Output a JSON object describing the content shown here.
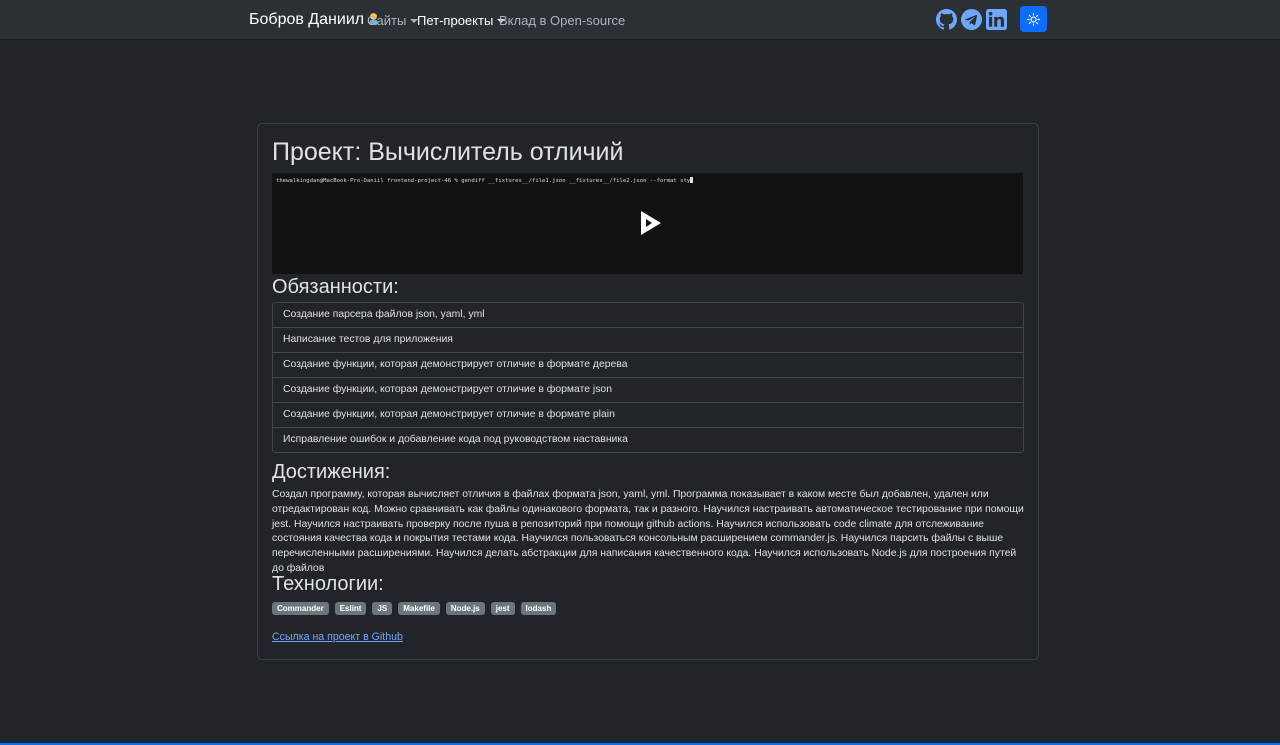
{
  "navbar": {
    "brand": "Бобров Даниил",
    "brand_emoji": "person-blond-hair-emoji",
    "items": [
      {
        "label": "Сайты",
        "dropdown": true,
        "active": false
      },
      {
        "label": "Пет-проекты",
        "dropdown": true,
        "active": true
      },
      {
        "label": "Вклад в Open-source",
        "dropdown": false,
        "active": false
      }
    ],
    "social_icons": [
      "github-icon",
      "telegram-icon",
      "linkedin-icon"
    ],
    "theme_toggle_icon": "sun-icon",
    "accent_color": "#0d6efd"
  },
  "project": {
    "title": "Проект: Вычислитель отличий",
    "demo": {
      "terminal_text": "thewalkingdan@MacBook-Pro-Daniil frontend-project-46 % gendiff __fixtures__/file1.json __fixtures__/file2.json --format sty",
      "play_icon": "play-icon"
    },
    "duties_heading": "Обязанности:",
    "duties": [
      "Создание парсера файлов json, yaml, yml",
      "Написание тестов для приложения",
      "Создание функции, которая демонстрирует отличие в формате дерева",
      "Создание функции, которая демонстрирует отличие в формате json",
      "Создание функции, которая демонстрирует отличие в формате plain",
      "Исправление ошибок и добавление кода под руководством наставника"
    ],
    "achievements_heading": "Достижения:",
    "achievements_text": "Создал программу, которая вычисляет отличия в файлах формата json, yaml, yml. Программа показывает в каком месте был добавлен, удален или отредактирован код. Можно сравнивать как файлы одинакового формата, так и разного. Научился настраивать автоматическое тестирование при помощи jest. Научился настраивать проверку после пуша в репозиторий при помощи github actions. Научился использовать code climate для отслеживание состояния качества кода и покрытия тестами кода. Научился пользоваться консольным расширением commander.js. Научился парсить файлы с выше перечисленными расширениями. Научился делать абстракции для написания качественного кода. Научился использовать Node.js для построения путей до файлов",
    "tech_heading": "Технологии:",
    "technologies": [
      "Commander",
      "Eslint",
      "JS",
      "Makefile",
      "Node.js",
      "jest",
      "lodash"
    ],
    "github_link": "Ссылка на проект в Github"
  }
}
